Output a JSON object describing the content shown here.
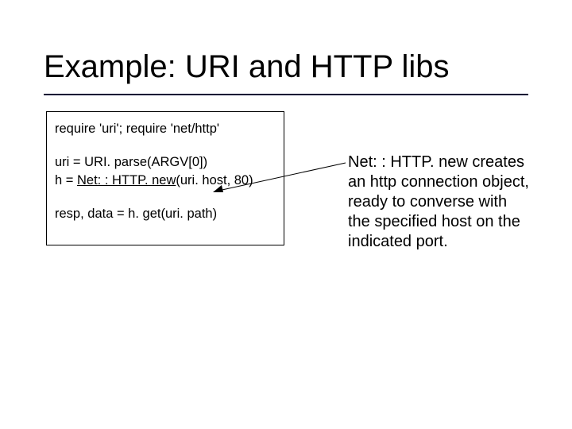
{
  "title": "Example: URI and HTTP libs",
  "code": {
    "line1": "require 'uri'; require  'net/http'",
    "line2": "uri = URI. parse(ARGV[0])",
    "line3_prefix": "h = ",
    "line3_mid": "Net: : HTTP. new",
    "line3_suffix": "(uri. host, 80)",
    "line4": "resp, data = h. get(uri. path)"
  },
  "annotation": {
    "lead": "Net: : HTTP. new",
    "rest": " creates an http connection object, ready to converse with the specified host on the indicated port."
  }
}
